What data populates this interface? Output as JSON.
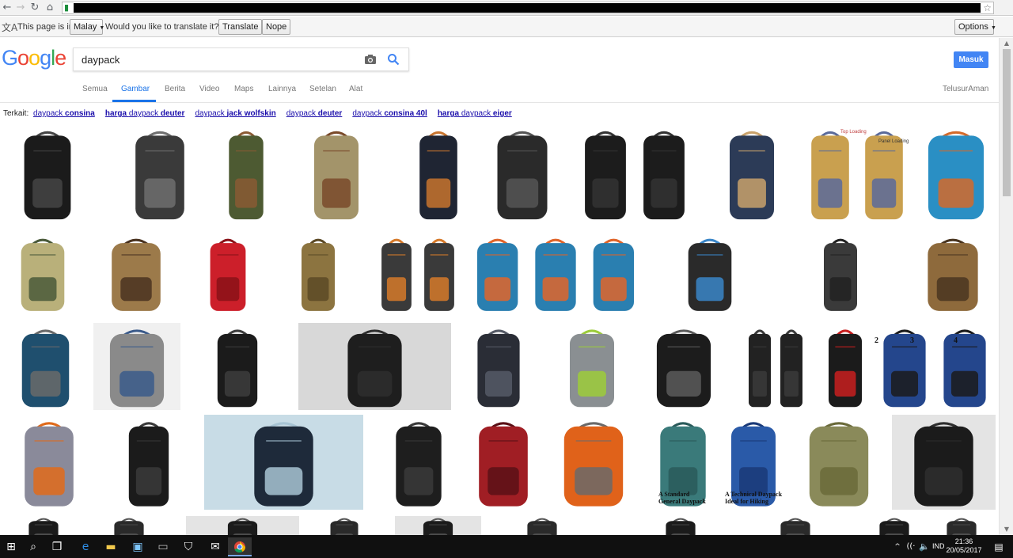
{
  "translate_bar": {
    "prefix": "This page is in",
    "language": "Malay",
    "question": "Would you like to translate it?",
    "translate_label": "Translate",
    "nope_label": "Nope",
    "options_label": "Options"
  },
  "search": {
    "logo": "Google",
    "query": "daypack",
    "signin_label": "Masuk",
    "tabs": [
      "Semua",
      "Gambar",
      "Berita",
      "Video",
      "Maps",
      "Lainnya",
      "Setelan",
      "Alat"
    ],
    "active_tab": "Gambar",
    "safesearch": "TelusurAman"
  },
  "related": {
    "label": "Terkait:",
    "items": [
      {
        "pre": "daypack ",
        "bold": "consina"
      },
      {
        "pre": "harga ",
        "mid": "daypack ",
        "bold": "deuter",
        "lead_bold": true
      },
      {
        "pre": "daypack ",
        "bold": "jack wolfskin"
      },
      {
        "pre": "daypack ",
        "bold": "deuter"
      },
      {
        "pre": "daypack ",
        "bold": "consina 40l"
      },
      {
        "pre": "harga ",
        "mid": "daypack ",
        "bold": "eiger",
        "lead_bold": true
      }
    ]
  },
  "captions": {
    "top_loading": "Top Loading",
    "panel_loading": "Panel Loading",
    "standard_1": "A Standard",
    "standard_2": "General Daypack",
    "technical_1": "A Technical Daypack",
    "technical_2": "Ideal for Hiking",
    "num_2": "2",
    "num_3": "3",
    "num_4": "4"
  },
  "images": [
    {
      "row": 0,
      "c": "#1b1b1b",
      "a": "#444444",
      "bg": "#ffffff"
    },
    {
      "row": 0,
      "c": "#3a3a3a",
      "a": "#6f6f6f",
      "bg": "#ffffff"
    },
    {
      "row": 0,
      "c": "#4d5a32",
      "a": "#8a5a34",
      "bg": "#ffffff"
    },
    {
      "row": 0,
      "c": "#a3946a",
      "a": "#7a4a2a",
      "bg": "#ffffff"
    },
    {
      "row": 0,
      "c": "#1f2533",
      "a": "#c8742e",
      "bg": "#ffffff"
    },
    {
      "row": 0,
      "c": "#2a2a2a",
      "a": "#555555",
      "bg": "#ffffff"
    },
    {
      "row": 0,
      "c": "#1c1c1c",
      "a": "#333333",
      "bg": "#ffffff"
    },
    {
      "row": 0,
      "c": "#2c3b57",
      "a": "#c9a26b",
      "bg": "#ffffff"
    },
    {
      "row": 0,
      "c": "#c9a04f",
      "a": "#5a6a9a",
      "bg": "#ffffff"
    },
    {
      "row": 0,
      "c": "#2a8fc4",
      "a": "#d46a2a",
      "bg": "#ffffff"
    },
    {
      "row": 1,
      "c": "#b9b07a",
      "a": "#4a5a3a",
      "bg": "#ffffff"
    },
    {
      "row": 1,
      "c": "#9c7a4a",
      "a": "#4a3320",
      "bg": "#ffffff"
    },
    {
      "row": 1,
      "c": "#cc1f2a",
      "a": "#8a1218",
      "bg": "#ffffff"
    },
    {
      "row": 1,
      "c": "#8c7440",
      "a": "#5c4a26",
      "bg": "#ffffff"
    },
    {
      "row": 1,
      "c": "#3a3a3a",
      "a": "#d67a2a",
      "bg": "#ffffff"
    },
    {
      "row": 1,
      "c": "#2a7fb0",
      "a": "#e0652a",
      "bg": "#ffffff"
    },
    {
      "row": 1,
      "c": "#2a2a2a",
      "a": "#3a86c8",
      "bg": "#ffffff"
    },
    {
      "row": 1,
      "c": "#3a3a3a",
      "a": "#222222",
      "bg": "#ffffff"
    },
    {
      "row": 1,
      "c": "#8e6a3c",
      "a": "#4a3520",
      "bg": "#ffffff"
    },
    {
      "row": 2,
      "c": "#1f4f6e",
      "a": "#6a6a6a",
      "bg": "#ffffff"
    },
    {
      "row": 2,
      "c": "#8a8a8a",
      "a": "#3a5a8a",
      "bg": "#f0f0f0"
    },
    {
      "row": 2,
      "c": "#1b1b1b",
      "a": "#3c3c3c",
      "bg": "#ffffff"
    },
    {
      "row": 2,
      "c": "#1e1e1e",
      "a": "#2e2e2e",
      "bg": "#d8d8d8"
    },
    {
      "row": 2,
      "c": "#2a2d36",
      "a": "#555a66",
      "bg": "#ffffff"
    },
    {
      "row": 2,
      "c": "#8a8f92",
      "a": "#9ccc3a",
      "bg": "#ffffff"
    },
    {
      "row": 2,
      "c": "#1c1c1c",
      "a": "#5a5a5a",
      "bg": "#ffffff"
    },
    {
      "row": 2,
      "c": "#222222",
      "a": "#3a3a3a",
      "bg": "#ffffff"
    },
    {
      "row": 2,
      "c": "#1b1b1b",
      "a": "#c81e1e",
      "bg": "#ffffff"
    },
    {
      "row": 2,
      "c": "#24468c",
      "a": "#1b1b1b",
      "bg": "#ffffff"
    },
    {
      "row": 3,
      "c": "#8a8a9a",
      "a": "#e06a1a",
      "bg": "#ffffff"
    },
    {
      "row": 3,
      "c": "#1b1b1b",
      "a": "#3a3a3a",
      "bg": "#ffffff"
    },
    {
      "row": 3,
      "c": "#1e2a3a",
      "a": "#a8c4d4",
      "bg": "#c8dce6"
    },
    {
      "row": 3,
      "c": "#1e1e1e",
      "a": "#3a3a3a",
      "bg": "#ffffff"
    },
    {
      "row": 3,
      "c": "#a01e24",
      "a": "#5a1016",
      "bg": "#ffffff"
    },
    {
      "row": 3,
      "c": "#e0621a",
      "a": "#6a6a6a",
      "bg": "#ffffff"
    },
    {
      "row": 3,
      "c": "#3a7a7a",
      "a": "#2a5a5a",
      "bg": "#ffffff"
    },
    {
      "row": 3,
      "c": "#2a5aa8",
      "a": "#1a3a78",
      "bg": "#ffffff"
    },
    {
      "row": 3,
      "c": "#8a8a5a",
      "a": "#6a6a3a",
      "bg": "#ffffff"
    },
    {
      "row": 3,
      "c": "#1b1b1b",
      "a": "#2e2e2e",
      "bg": "#e4e4e4"
    }
  ]
}
